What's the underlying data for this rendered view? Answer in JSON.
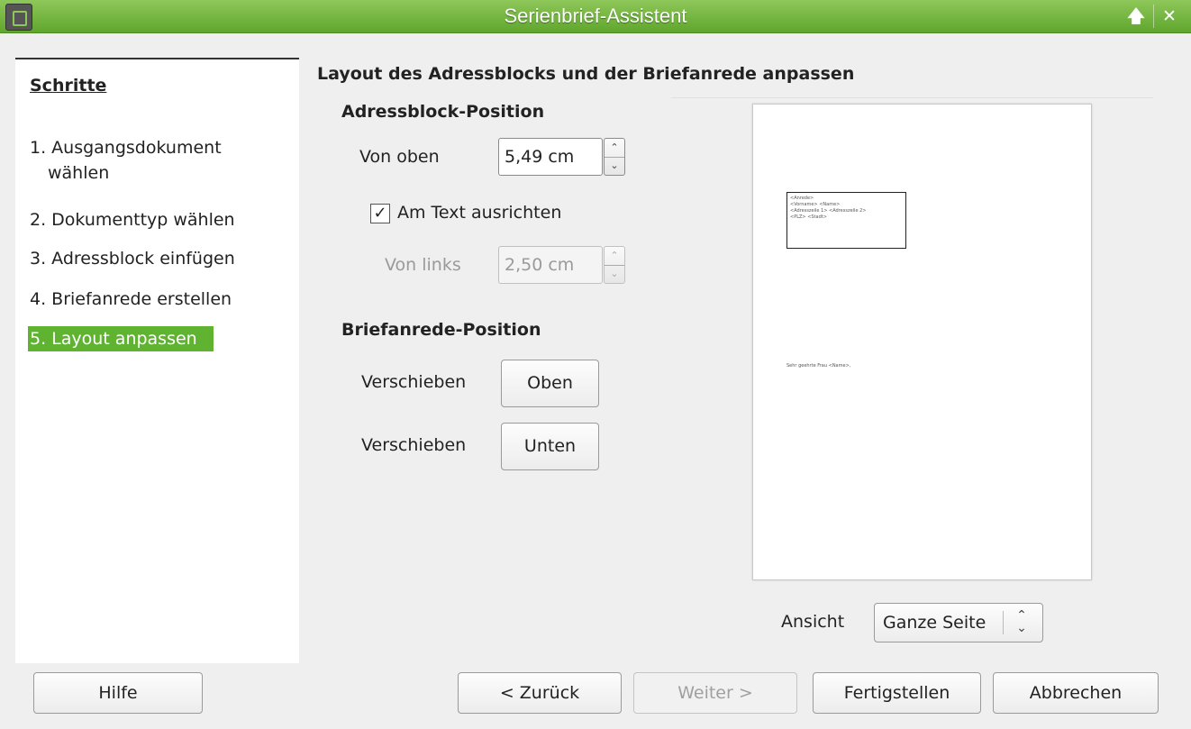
{
  "window": {
    "title": "Serienbrief-Assistent"
  },
  "steps": {
    "heading": "Schritte",
    "items": [
      {
        "label_line1": "1. Ausgangsdokument",
        "label_line2": "wählen"
      },
      {
        "label": "2. Dokumenttyp wählen"
      },
      {
        "label": "3. Adressblock einfügen"
      },
      {
        "label": "4. Briefanrede erstellen"
      },
      {
        "label": "5. Layout anpassen",
        "active": true
      }
    ]
  },
  "main": {
    "title": "Layout des Adressblocks und der Briefanrede anpassen",
    "address_section": {
      "heading": "Adressblock-Position",
      "from_top_label": "Von oben",
      "from_top_value": "5,49 cm",
      "align_text_label": "Am Text ausrichten",
      "align_text_checked": true,
      "from_left_label": "Von links",
      "from_left_value": "2,50 cm"
    },
    "greeting_section": {
      "heading": "Briefanrede-Position",
      "move_label_1": "Verschieben",
      "up_button": "Oben",
      "move_label_2": "Verschieben",
      "down_button": "Unten"
    },
    "preview": {
      "address_lines": [
        "<Anrede>",
        "<Vorname> <Name>",
        "<Adresszeile 1> <Adresszeile 2>",
        "<PLZ> <Stadt>"
      ],
      "greeting_line": "Sehr geehrte Frau <Name>,"
    },
    "view": {
      "label": "Ansicht",
      "value": "Ganze Seite"
    }
  },
  "buttons": {
    "help": "Hilfe",
    "back": "< Zurück",
    "next": "Weiter >",
    "finish": "Fertigstellen",
    "cancel": "Abbrechen"
  },
  "colors": {
    "titlebar": "#6db33a",
    "active_step": "#5fb331"
  }
}
